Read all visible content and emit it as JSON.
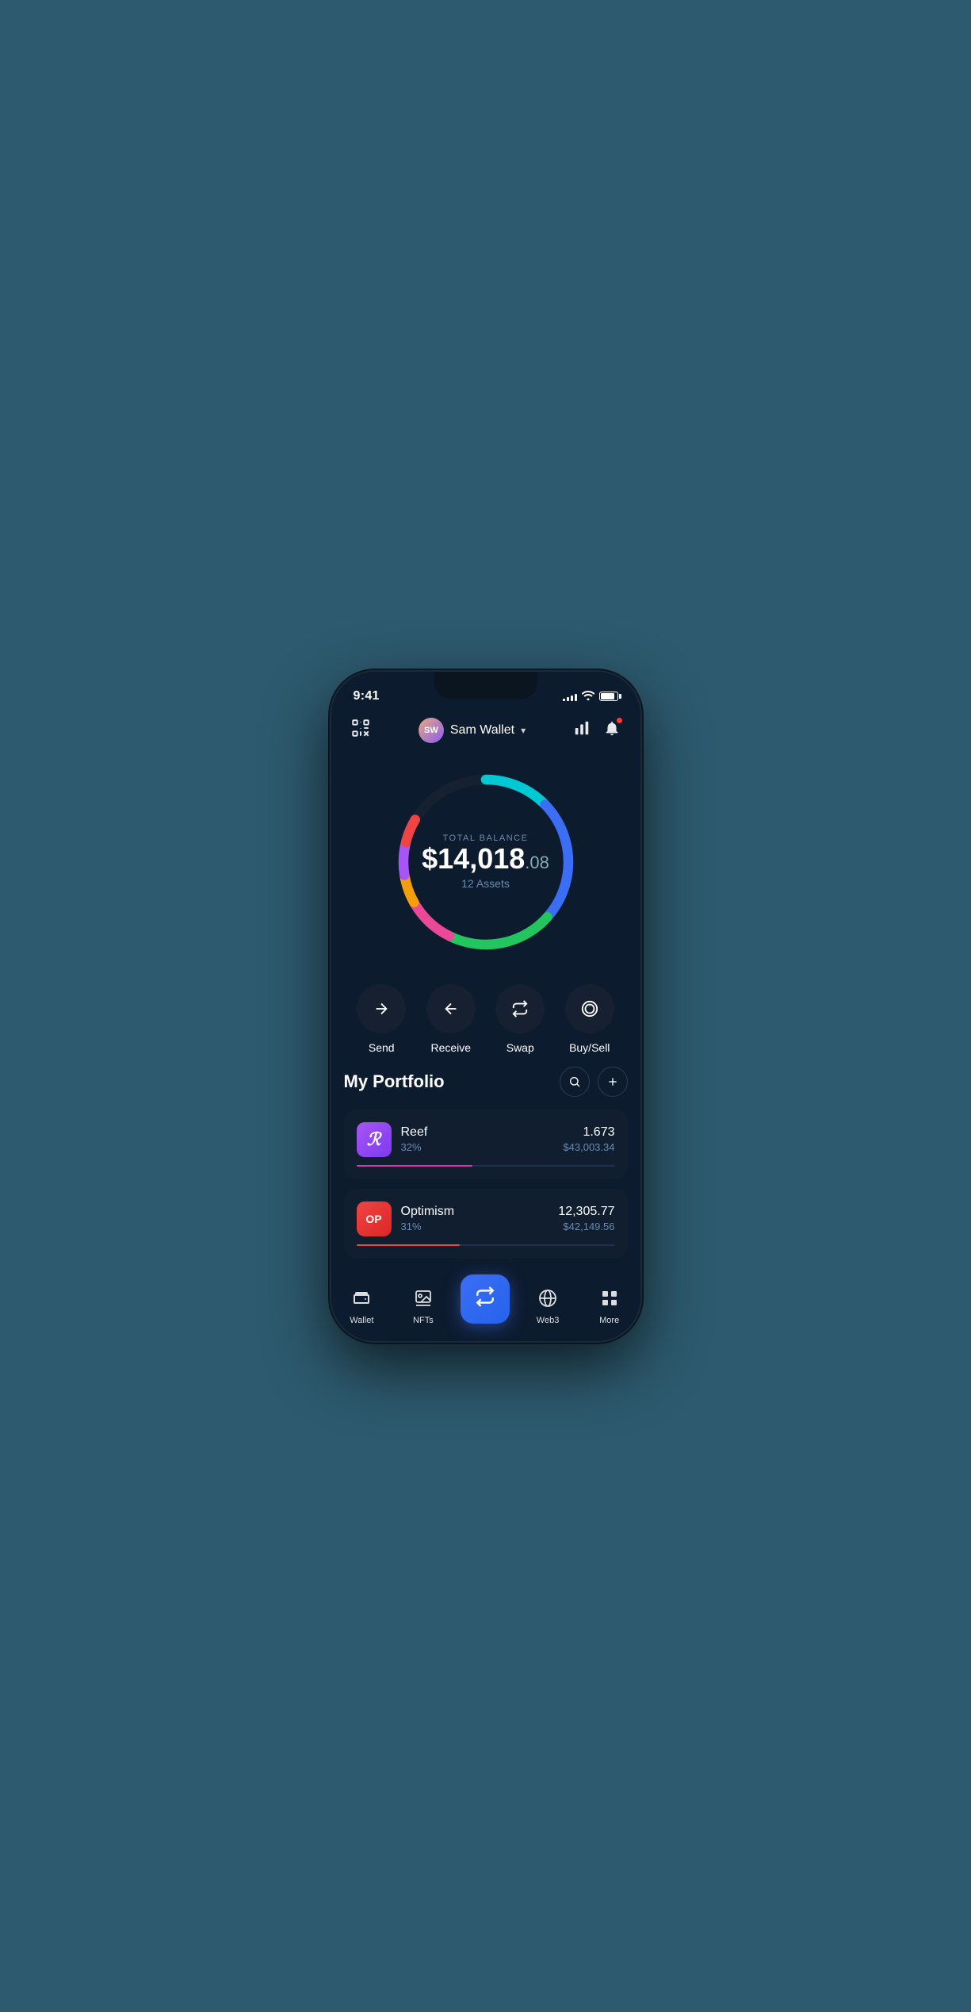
{
  "status": {
    "time": "9:41",
    "signal_bars": [
      3,
      5,
      7,
      9,
      11
    ],
    "battery_percent": 85
  },
  "header": {
    "scan_label": "scan",
    "wallet_name": "Sam Wallet",
    "wallet_avatar_initials": "SW",
    "chart_label": "analytics",
    "bell_label": "notifications",
    "has_notification": true
  },
  "balance": {
    "label": "TOTAL BALANCE",
    "amount_main": "$14,018",
    "amount_cents": ".08",
    "assets_count": "12 Assets"
  },
  "actions": [
    {
      "id": "send",
      "label": "Send",
      "icon": "→"
    },
    {
      "id": "receive",
      "label": "Receive",
      "icon": "←"
    },
    {
      "id": "swap",
      "label": "Swap",
      "icon": "⇅"
    },
    {
      "id": "buysell",
      "label": "Buy/Sell",
      "icon": "◎"
    }
  ],
  "portfolio": {
    "title": "My Portfolio",
    "search_label": "search",
    "add_label": "add",
    "assets": [
      {
        "id": "reef",
        "name": "Reef",
        "percent": "32%",
        "amount": "1.673",
        "usd": "$43,003.34",
        "bar_color": "#d63aaf",
        "bar_width": "45%",
        "icon_text": "R",
        "icon_bg": "linear-gradient(135deg, #a855f7, #7c3aed)"
      },
      {
        "id": "optimism",
        "name": "Optimism",
        "percent": "31%",
        "amount": "12,305.77",
        "usd": "$42,149.56",
        "bar_color": "#ef4444",
        "bar_width": "40%",
        "icon_text": "OP",
        "icon_bg": "linear-gradient(135deg, #ef4444, #dc2626)"
      }
    ]
  },
  "donut": {
    "segments": [
      {
        "color": "#00bcd4",
        "dash": 62,
        "offset": 0
      },
      {
        "color": "#3b82f6",
        "dash": 85,
        "offset": -62
      },
      {
        "color": "#22c55e",
        "dash": 55,
        "offset": -147
      },
      {
        "color": "#ec4899",
        "dash": 30,
        "offset": -202
      },
      {
        "color": "#f59e0b",
        "dash": 18,
        "offset": -232
      },
      {
        "color": "#a855f7",
        "dash": 22,
        "offset": -250
      },
      {
        "color": "#ef4444",
        "dash": 20,
        "offset": -272
      }
    ],
    "circumference": 706,
    "radius": 112.5
  },
  "bottom_nav": [
    {
      "id": "wallet",
      "label": "Wallet",
      "icon": "wallet",
      "active": true
    },
    {
      "id": "nfts",
      "label": "NFTs",
      "icon": "nfts",
      "active": false
    },
    {
      "id": "center",
      "label": "",
      "icon": "swap-center",
      "active": false,
      "is_center": true
    },
    {
      "id": "web3",
      "label": "Web3",
      "icon": "web3",
      "active": false
    },
    {
      "id": "more",
      "label": "More",
      "icon": "more",
      "active": false
    }
  ]
}
